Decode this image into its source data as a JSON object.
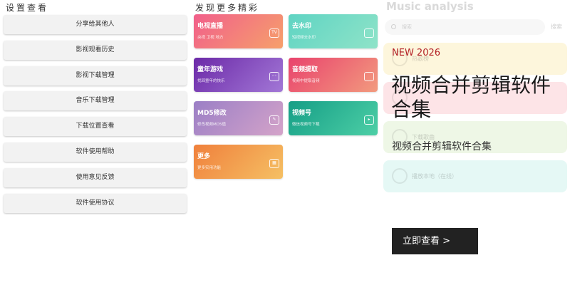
{
  "settings": {
    "title": "设置查看",
    "items": [
      {
        "label": "分享给其他人"
      },
      {
        "label": "影视观看历史"
      },
      {
        "label": "影视下载管理"
      },
      {
        "label": "音乐下载管理"
      },
      {
        "label": "下载位置查看"
      },
      {
        "label": "软件使用帮助"
      },
      {
        "label": "使用意见反馈"
      },
      {
        "label": "软件使用协议"
      }
    ]
  },
  "discover": {
    "title": "发现更多精彩",
    "tiles": [
      {
        "title": "电视直播",
        "sub": "央视 卫视 地方",
        "icon": "tv-icon",
        "glyph": "TV",
        "from": "#f15f8b",
        "to": "#f6a06b"
      },
      {
        "title": "去水印",
        "sub": "短视频去水印",
        "icon": "frame-icon",
        "glyph": "",
        "from": "#5fd4c3",
        "to": "#8fe3c8"
      },
      {
        "title": "童年游戏",
        "sub": "找回童年的快乐",
        "icon": "gamepad-icon",
        "glyph": "◦◦",
        "from": "#6c2aa8",
        "to": "#a277d6"
      },
      {
        "title": "音频提取",
        "sub": "视频中提取音频",
        "icon": "audio-icon",
        "glyph": "",
        "from": "#e9436d",
        "to": "#f29a7e"
      },
      {
        "title": "MD5修改",
        "sub": "修改视频MD5值",
        "icon": "edit-icon",
        "glyph": "✎",
        "from": "#9b7fc6",
        "to": "#d4a3c9"
      },
      {
        "title": "视频号",
        "sub": "微信视频号下载",
        "icon": "play-icon",
        "glyph": "▸",
        "from": "#159e86",
        "to": "#4dcfa6"
      },
      {
        "title": "更多",
        "sub": "更多实用功能",
        "icon": "grid-icon",
        "glyph": "▦",
        "from": "#f0803c",
        "to": "#f5c064"
      }
    ]
  },
  "music": {
    "title": "Music analysis",
    "search_placeholder": "搜索",
    "search_button": "搜索",
    "cards": [
      {
        "label": "热歌榜",
        "color": "#fdf6dc"
      },
      {
        "label": "",
        "color": "#fde4e7"
      },
      {
        "label": "下载歌曲",
        "color": "#eef7e6"
      },
      {
        "label": "播放本地（在线）",
        "color": "#e5f8f5"
      }
    ]
  },
  "ad": {
    "tag": "NEW 2026",
    "headline": "视频合并剪辑软件合集",
    "subtitle": "视频合并剪辑软件合集",
    "cta": "立即查看 >"
  }
}
